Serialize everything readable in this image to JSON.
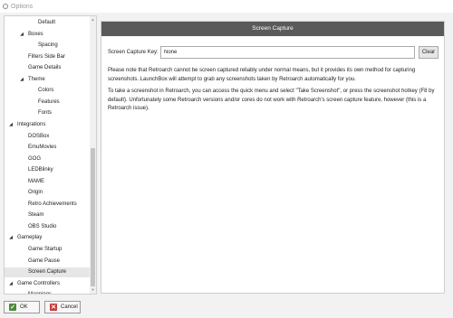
{
  "window": {
    "title": "Options"
  },
  "tree": {
    "items": [
      {
        "label": "Default",
        "level": 2,
        "expanded": null,
        "selected": false
      },
      {
        "label": "Boxes",
        "level": 1,
        "expanded": true,
        "selected": false
      },
      {
        "label": "Spacing",
        "level": 2,
        "expanded": null,
        "selected": false
      },
      {
        "label": "Filters Side Bar",
        "level": 1,
        "expanded": null,
        "selected": false
      },
      {
        "label": "Game Details",
        "level": 1,
        "expanded": null,
        "selected": false
      },
      {
        "label": "Theme",
        "level": 1,
        "expanded": true,
        "selected": false
      },
      {
        "label": "Colors",
        "level": 2,
        "expanded": null,
        "selected": false
      },
      {
        "label": "Features",
        "level": 2,
        "expanded": null,
        "selected": false
      },
      {
        "label": "Fonts",
        "level": 2,
        "expanded": null,
        "selected": false
      },
      {
        "label": "Integrations",
        "level": 0,
        "expanded": true,
        "selected": false
      },
      {
        "label": "DOSBox",
        "level": 1,
        "expanded": null,
        "selected": false
      },
      {
        "label": "EmuMovies",
        "level": 1,
        "expanded": null,
        "selected": false
      },
      {
        "label": "GOG",
        "level": 1,
        "expanded": null,
        "selected": false
      },
      {
        "label": "LEDBlinky",
        "level": 1,
        "expanded": null,
        "selected": false
      },
      {
        "label": "MAME",
        "level": 1,
        "expanded": null,
        "selected": false
      },
      {
        "label": "Origin",
        "level": 1,
        "expanded": null,
        "selected": false
      },
      {
        "label": "Retro Achievements",
        "level": 1,
        "expanded": null,
        "selected": false
      },
      {
        "label": "Steam",
        "level": 1,
        "expanded": null,
        "selected": false
      },
      {
        "label": "OBS Studio",
        "level": 1,
        "expanded": null,
        "selected": false
      },
      {
        "label": "Gameplay",
        "level": 0,
        "expanded": true,
        "selected": false
      },
      {
        "label": "Game Startup",
        "level": 1,
        "expanded": null,
        "selected": false
      },
      {
        "label": "Game Pause",
        "level": 1,
        "expanded": null,
        "selected": false
      },
      {
        "label": "Screen Capture",
        "level": 1,
        "expanded": null,
        "selected": true
      },
      {
        "label": "Game Controllers",
        "level": 0,
        "expanded": true,
        "selected": false
      },
      {
        "label": "Mappings",
        "level": 1,
        "expanded": null,
        "selected": false
      }
    ]
  },
  "panel": {
    "header": "Screen Capture",
    "field_label": "Screen Capture Key:",
    "field_value": "None",
    "clear_label": "Clear",
    "paragraph1_line1": "Please note that Retroarch cannot be screen captured reliably under normal means, but it provides its own method for capturing",
    "paragraph1_line2": "screenshots. LaunchBox will attempt to grab any screenshots taken by Retroarch automatically for you.",
    "paragraph2_line1": "To take a screenshot in Retroarch, you can access the quick menu and select \"Take Screenshot\", or press the screenshot hotkey (F8 by",
    "paragraph2_line2": "default). Unfortunately some Retroarch versions and/or cores do not work with Retroarch's screen capture feature, however (this is a",
    "paragraph2_line3": "Retroarch issue)."
  },
  "buttons": {
    "ok": "OK",
    "cancel": "Cancel"
  },
  "icons": {
    "window": "app-icon",
    "tree_expanded": "chevron-down-icon",
    "ok": "checkmark-icon",
    "cancel": "x-icon"
  },
  "colors": {
    "header_bg": "#5a5a5a",
    "ok_icon": "#4d8a3c",
    "cancel_icon": "#c63c3c",
    "selected_row": "#e6e6e6"
  }
}
